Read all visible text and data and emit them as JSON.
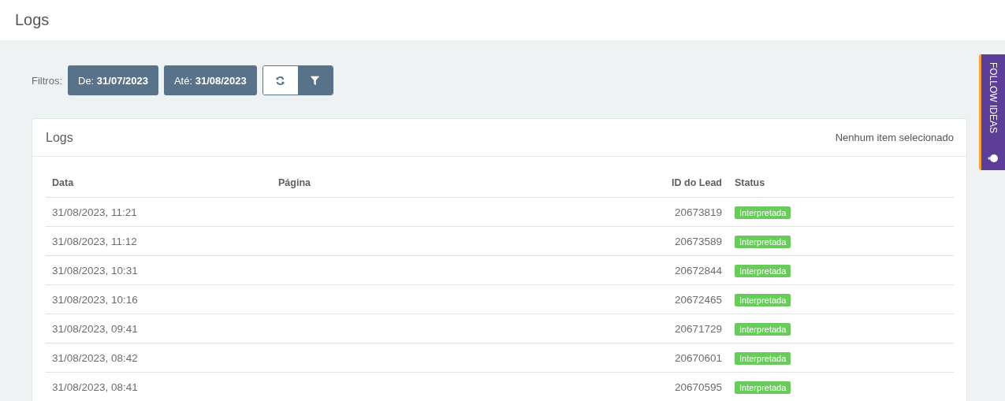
{
  "page": {
    "title": "Logs"
  },
  "filters": {
    "label": "Filtros:",
    "from": "De: **31/07/2023**",
    "to": "Até: **31/08/2023**"
  },
  "card": {
    "title": "Logs",
    "selection": "Nenhum item selecionado"
  },
  "table": {
    "columns": [
      "Data",
      "Página",
      "ID do Lead",
      "Status"
    ],
    "rows": [
      {
        "date": "31/08/2023, 11:21",
        "lead_id": "20673819",
        "status": "Interpretada"
      },
      {
        "date": "31/08/2023, 11:12",
        "lead_id": "20673589",
        "status": "Interpretada"
      },
      {
        "date": "31/08/2023, 10:31",
        "lead_id": "20672844",
        "status": "Interpretada"
      },
      {
        "date": "31/08/2023, 10:16",
        "lead_id": "20672465",
        "status": "Interpretada"
      },
      {
        "date": "31/08/2023, 09:41",
        "lead_id": "20671729",
        "status": "Interpretada"
      },
      {
        "date": "31/08/2023, 08:42",
        "lead_id": "20670601",
        "status": "Interpretada"
      },
      {
        "date": "31/08/2023, 08:41",
        "lead_id": "20670595",
        "status": "Interpretada"
      }
    ]
  },
  "side_tab": {
    "label": "FOLLOW IDEAS"
  }
}
